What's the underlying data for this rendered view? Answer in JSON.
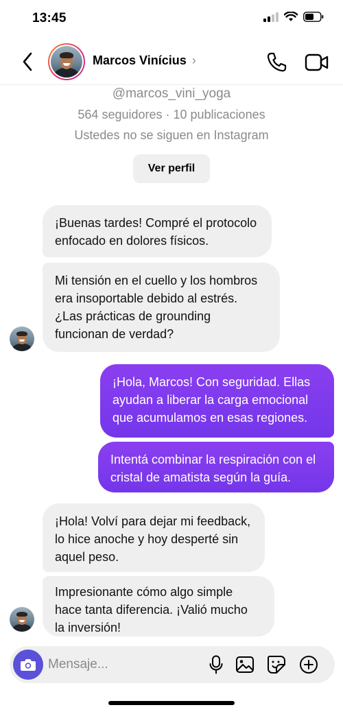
{
  "status_bar": {
    "time": "13:45"
  },
  "header": {
    "contact_name": "Marcos Vinícius",
    "chevron": "›",
    "icons": {
      "back": "chevron-left-icon",
      "call": "phone-icon",
      "video": "video-camera-icon"
    }
  },
  "profile": {
    "handle": "@marcos_vini_yoga",
    "stats": "564 seguidores · 10 publicaciones",
    "follow_note": "Ustedes no se siguen en Instagram",
    "view_profile_label": "Ver perfil"
  },
  "messages": [
    {
      "direction": "incoming",
      "lines": [
        "¡Buenas tardes! Compré el protocolo",
        "enfocado en dolores físicos."
      ]
    },
    {
      "direction": "incoming",
      "lines": [
        "Mi tensión en el cuello y los hombros",
        "era insoportable debido al estrés.",
        "¿Las prácticas de grounding",
        "funcionan de verdad?"
      ]
    },
    {
      "direction": "outgoing",
      "lines": [
        "¡Hola, Marcos! Con seguridad. Ellas",
        "ayudan a liberar la carga emocional",
        "que acumulamos en esas regiones."
      ]
    },
    {
      "direction": "outgoing",
      "lines": [
        "Intentá combinar la respiración con el",
        "cristal de amatista según la guía."
      ]
    },
    {
      "direction": "incoming",
      "lines": [
        "¡Hola! Volví para dejar mi feedback,",
        "lo hice anoche y hoy desperté sin",
        "aquel peso."
      ]
    },
    {
      "direction": "incoming",
      "lines": [
        "Impresionante cómo algo simple",
        "hace tanta diferencia. ¡Valió mucho",
        "la inversión!"
      ]
    }
  ],
  "composer": {
    "placeholder": "Mensaje...",
    "icons": [
      "camera-icon",
      "microphone-icon",
      "image-icon",
      "sticker-icon",
      "plus-circle-icon"
    ]
  },
  "colors": {
    "outgoing_bubble": "#7a3df0",
    "incoming_bubble": "#efefef",
    "camera_button": "#5b51d8"
  }
}
